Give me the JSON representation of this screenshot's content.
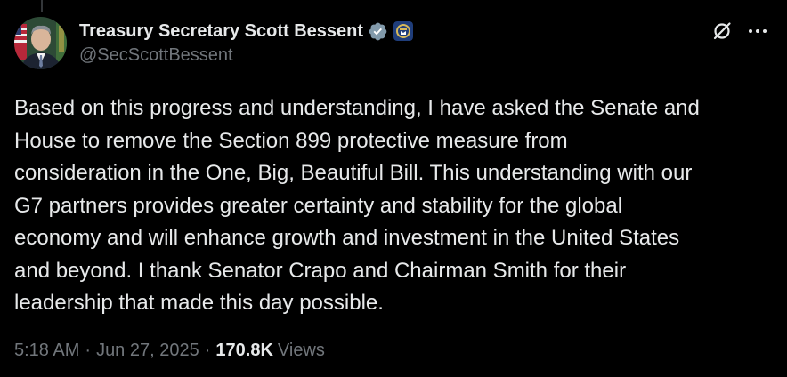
{
  "tweet": {
    "author": {
      "display_name": "Treasury Secretary Scott Bessent",
      "handle": "@SecScottBessent"
    },
    "text": "Based on this progress and understanding, I have asked the Senate and\nHouse to remove the Section 899 protective measure from\nconsideration in the One, Big, Beautiful Bill. This understanding with our\nG7 partners provides greater certainty and stability for the global\neconomy and will enhance growth and investment in the United States\nand beyond. I thank Senator Crapo and Chairman Smith for their\nleadership that made this day possible.",
    "time": "5:18 AM",
    "date": "Jun 27, 2025",
    "separator": "·",
    "views_count": "170.8K",
    "views_label": "Views"
  },
  "icons": {
    "verified": "verified-badge-icon",
    "affiliate": "treasury-seal-icon",
    "grok": "grok-icon",
    "more": "more-options-icon"
  },
  "colors": {
    "background": "#000000",
    "primary_text": "#e7e9ea",
    "secondary_text": "#71767b",
    "verified_badge": "#829aab"
  }
}
